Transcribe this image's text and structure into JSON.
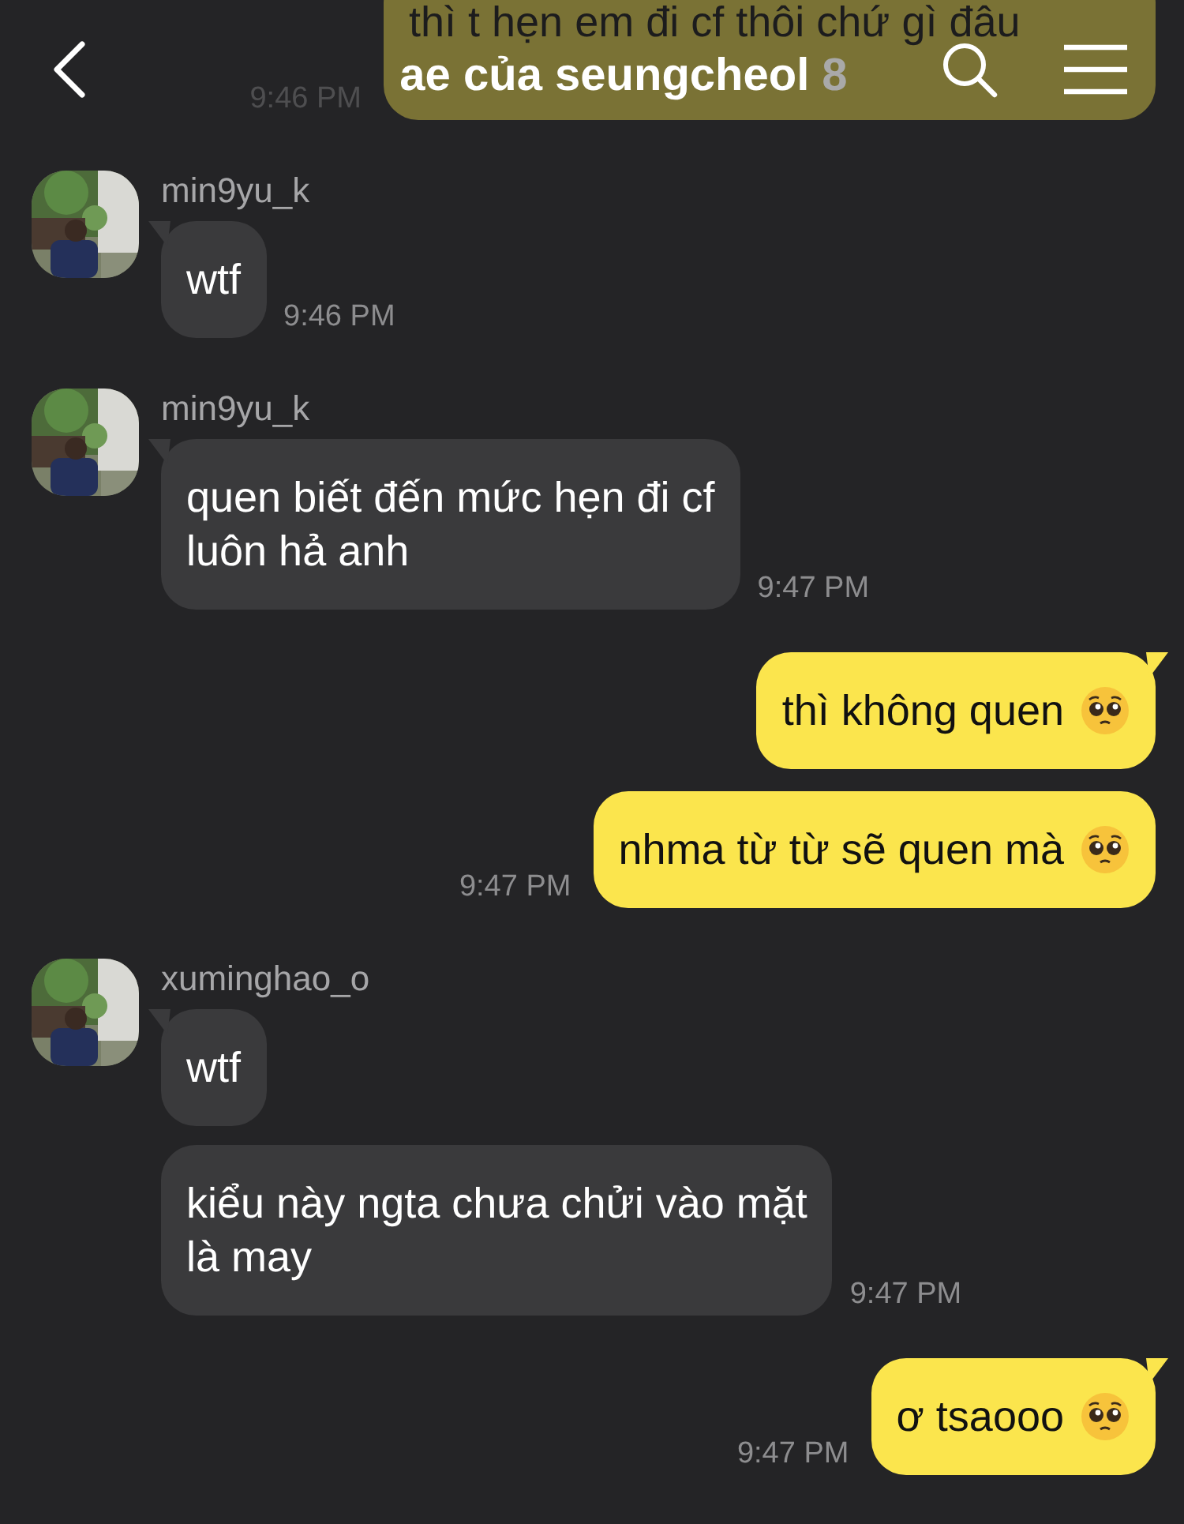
{
  "header": {
    "title": "ae của seungcheol",
    "member_count": "8"
  },
  "messages": [
    {
      "kind": "outgoing",
      "text": "thì t hẹn em đi cf thôi chứ gì đâu",
      "time": "9:46 PM",
      "emoji": false,
      "tail": false
    },
    {
      "kind": "incoming",
      "sender": "min9yu_k",
      "text": "wtf",
      "time": "9:46 PM",
      "tail": true
    },
    {
      "kind": "incoming",
      "sender": "min9yu_k",
      "text": "quen biết đến mức hẹn đi cf\nluôn hả anh",
      "time": "9:47 PM",
      "tail": true
    },
    {
      "kind": "outgoing",
      "text": "thì không quen",
      "emoji": true,
      "tail": true
    },
    {
      "kind": "outgoing",
      "text": "nhma từ từ sẽ quen mà",
      "emoji": true,
      "time": "9:47 PM",
      "tail": false
    },
    {
      "kind": "incoming",
      "sender": "xuminghao_o",
      "text": "wtf",
      "tail": true
    },
    {
      "kind": "incoming",
      "text": "kiểu này ngta chưa chửi vào mặt\nlà may",
      "time": "9:47 PM",
      "tail": false
    },
    {
      "kind": "outgoing",
      "text": "ơ tsaooo",
      "emoji": true,
      "time": "9:47 PM",
      "tail": true
    }
  ]
}
